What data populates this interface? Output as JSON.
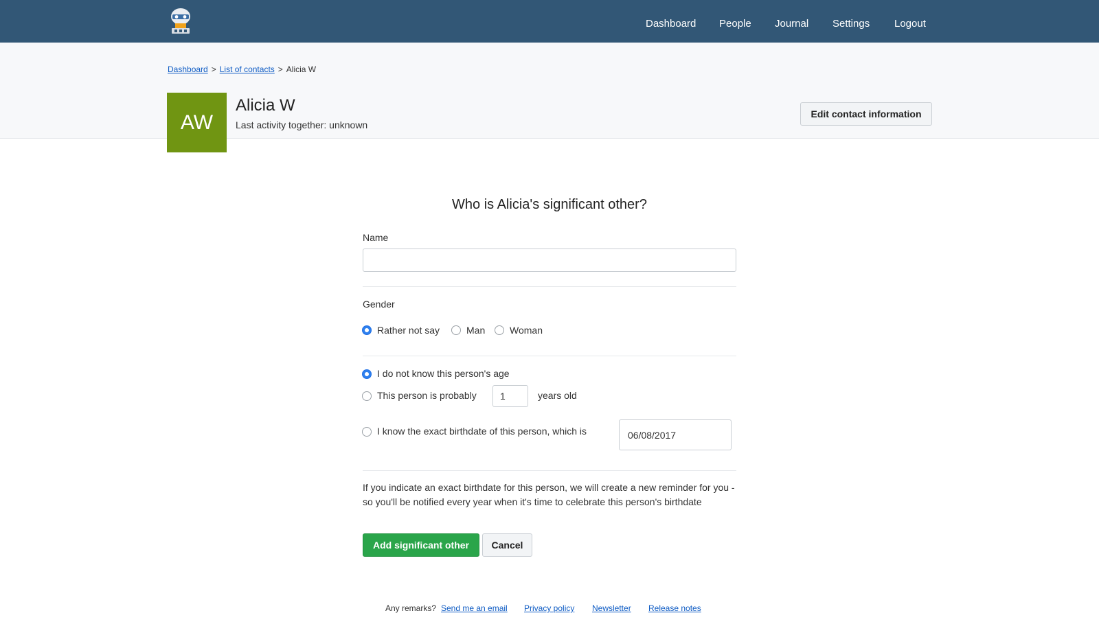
{
  "nav": {
    "items": [
      "Dashboard",
      "People",
      "Journal",
      "Settings",
      "Logout"
    ]
  },
  "breadcrumb": {
    "dashboard": "Dashboard",
    "list": "List of contacts",
    "current": "Alicia W",
    "separator": ">"
  },
  "contact": {
    "initials": "AW",
    "name": "Alicia W",
    "last_activity": "Last activity together: unknown",
    "edit_label": "Edit contact information",
    "avatar_color": "#709512"
  },
  "form": {
    "title": "Who is Alicia's significant other?",
    "name_label": "Name",
    "name_value": "",
    "gender_label": "Gender",
    "gender_options": [
      "Rather not say",
      "Man",
      "Woman"
    ],
    "gender_selected": "Rather not say",
    "age_unknown_label": "I do not know this person's age",
    "age_probably_label": "This person is probably",
    "age_value": "1",
    "age_suffix": "years old",
    "birthdate_label": "I know the exact birthdate of this person, which is",
    "birthdate_value": "06/08/2017",
    "age_selected": "I do not know this person's age",
    "info_text": "If you indicate an exact birthdate for this person, we will create a new reminder for you - so you'll be notified every year when it's time to celebrate this person's birthdate",
    "submit_label": "Add significant other",
    "cancel_label": "Cancel"
  },
  "footer": {
    "remarks": "Any remarks?",
    "links": [
      "Send me an email",
      "Privacy policy",
      "Newsletter",
      "Release notes"
    ]
  },
  "colors": {
    "topbar": "#325776",
    "primary_button": "#2aa54a",
    "link": "#0f5cc4",
    "radio_selected": "#2f80ed"
  }
}
